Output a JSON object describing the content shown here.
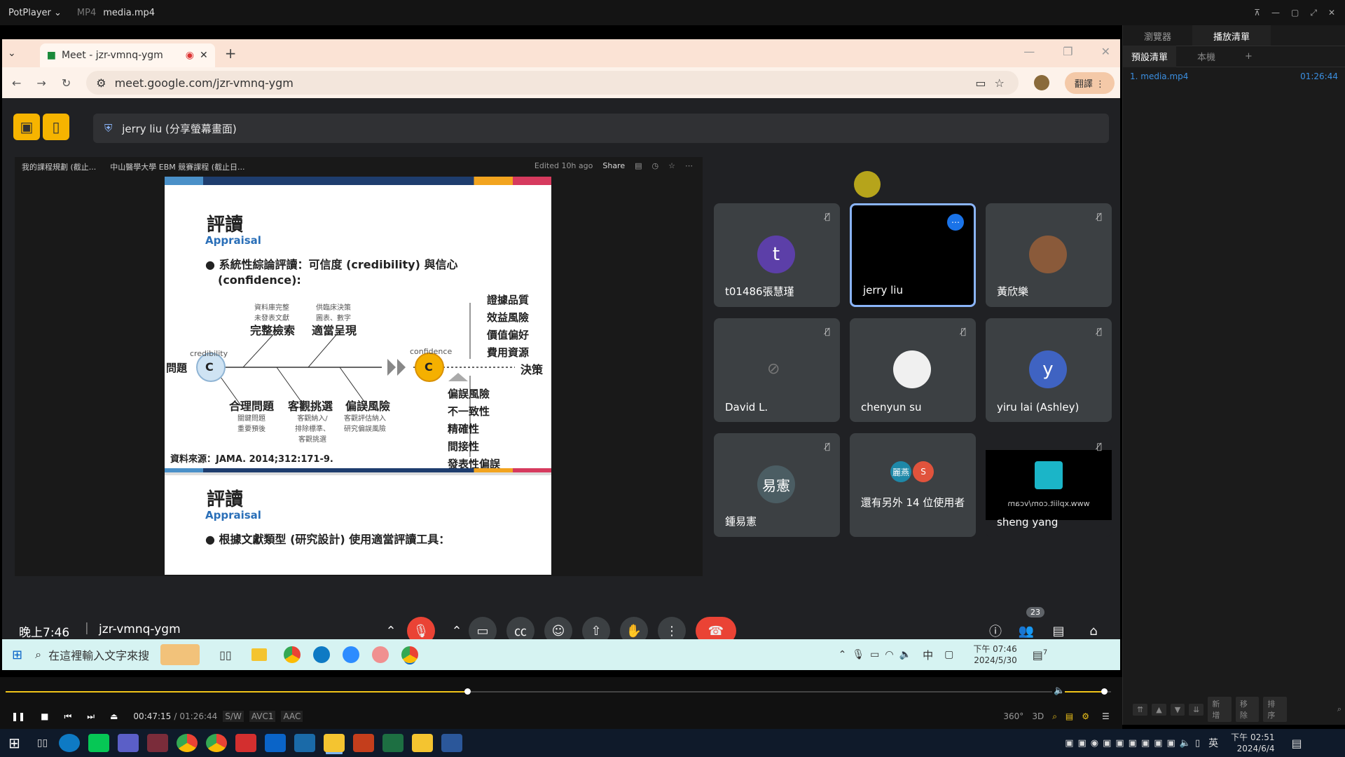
{
  "player": {
    "app_name": "PotPlayer",
    "format": "MP4",
    "file_name": "media.mp4",
    "elapsed": "00:47:15",
    "separator": "/",
    "total": "01:26:44",
    "codec_sw": "S/W",
    "codec_video": "AVC1",
    "codec_audio": "AAC",
    "progress": 0.441,
    "volume": 0.85
  },
  "sidebar": {
    "tab_browser": "瀏覽器",
    "tab_playlist": "播放清單",
    "subtab_default": "預設清單",
    "subtab_local": "本機",
    "subtab_add": "+",
    "items": [
      {
        "label": "1. media.mp4",
        "duration": "01:26:44"
      }
    ],
    "bottom": [
      "新增",
      "移除",
      "排序"
    ]
  },
  "browser": {
    "tab_title": "Meet - jzr-vmnq-ygm",
    "url": "meet.google.com/jzr-vmnq-ygm",
    "translate_label": "翻譯"
  },
  "meet": {
    "presenter_label": "jerry liu (分享螢幕畫面)",
    "time": "晚上7:46",
    "meeting_code": "jzr-vmnq-ygm",
    "participant_count": "23",
    "participants": [
      {
        "name": "t01486張慧瑾",
        "initial": "t",
        "color": "#5c3fa8"
      },
      {
        "name": "jerry liu",
        "initial": "",
        "color": "#000000"
      },
      {
        "name": "黃欣樂",
        "initial": "",
        "color": "#8a5a3a"
      },
      {
        "name": "David L.",
        "initial": "",
        "color": "#3c4043"
      },
      {
        "name": "chenyun su",
        "initial": "",
        "color": "#f0f0f0"
      },
      {
        "name": "yiru lai (Ashley)",
        "initial": "y",
        "color": "#3f63c2"
      },
      {
        "name": "鍾易憲",
        "initial": "易憲",
        "color": "#4b5d63"
      },
      {
        "name": "還有另外 14 位使用者",
        "initial": "",
        "color": "#3c4043"
      },
      {
        "name": "sheng yang",
        "initial": "",
        "color": "#202124"
      }
    ],
    "others_avatars": [
      "麗燕",
      "S"
    ],
    "watermark_text": "www.xpliit.com/vcam"
  },
  "shared_doc": {
    "crumb1": "我的課程規劃 (截止...",
    "crumb2": "中山醫學大學 EBM 競賽課程 (截止日...",
    "edited": "Edited 10h ago",
    "share": "Share"
  },
  "slide": {
    "title": "評讀",
    "subtitle": "Appraisal",
    "bullet1a": "系統性綜論評讀：可信度 (credibility) 與信心",
    "bullet1b": "(confidence):",
    "credibility": "credibility",
    "confidence": "confidence",
    "question": "問題",
    "c": "C",
    "decision": "決策",
    "top_left_small": "資料庫完整\n未發表文獻",
    "top_left_big": "完整檢索",
    "top_mid_small": "供臨床決策\n圖表、數字",
    "top_mid_big": "適當呈現",
    "right_top": [
      "證據品質",
      "效益風險",
      "價值偏好",
      "費用資源"
    ],
    "right_bottom": [
      "偏誤風險",
      "不一致性",
      "精確性",
      "間接性",
      "發表性偏誤"
    ],
    "bl_big": [
      "合理問題",
      "客觀挑選",
      "偏誤風險"
    ],
    "bl_small": [
      "關鍵問題\n重要預後",
      "客觀納入/\n排除標準、\n客觀挑選",
      "客觀評估納入\n研究偏誤風險"
    ],
    "source": "資料來源：JAMA. 2014;312:171-9.",
    "title2": "評讀",
    "subtitle2": "Appraisal",
    "bullet2": "根據文獻類型 (研究設計) 使用適當評讀工具："
  },
  "inner_taskbar": {
    "search_placeholder": "在這裡輸入文字來搜",
    "time": "下午 07:46",
    "date": "2024/5/30",
    "ime": "中",
    "notif": "7"
  },
  "os_taskbar": {
    "ime": "英",
    "time": "下午 02:51",
    "date": "2024/6/4"
  }
}
